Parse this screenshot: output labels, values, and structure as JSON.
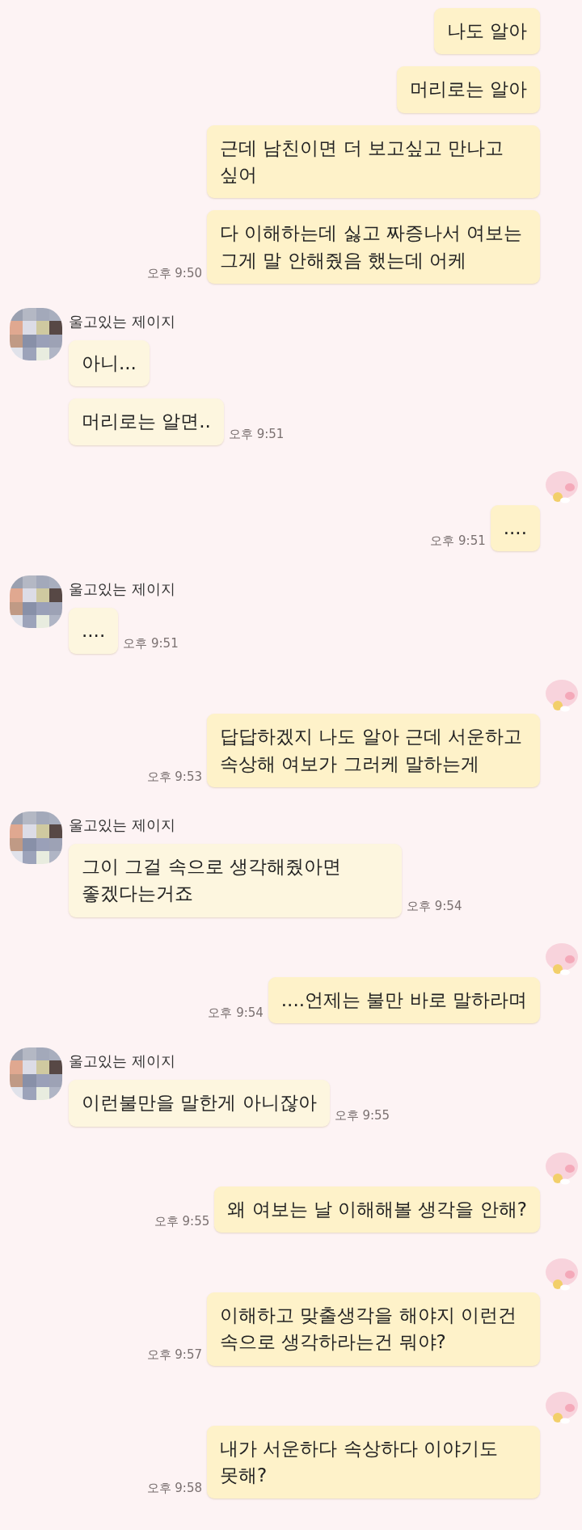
{
  "groups": [
    {
      "kind": "me",
      "show_sticker": false,
      "messages": [
        {
          "text": "나도 알아"
        },
        {
          "text": "머리로는 알아"
        },
        {
          "text": "근데 남친이면 더 보고싶고 만나고 싶어"
        },
        {
          "text": "다 이해하는데 싫고 짜증나서 여보는 그게 말 안해줬음 했는데 어케",
          "time": "오후 9:50"
        }
      ]
    },
    {
      "kind": "other",
      "sender": "울고있는 제이지",
      "messages": [
        {
          "text": "아니..."
        },
        {
          "text": "머리로는 알면..",
          "time": "오후 9:51"
        }
      ]
    },
    {
      "kind": "me",
      "show_sticker": true,
      "messages": [
        {
          "text": "....",
          "time": "오후 9:51"
        }
      ]
    },
    {
      "kind": "other",
      "sender": "울고있는 제이지",
      "messages": [
        {
          "text": "....",
          "time": "오후 9:51"
        }
      ]
    },
    {
      "kind": "me",
      "show_sticker": true,
      "messages": [
        {
          "text": "답답하겠지 나도 알아 근데 서운하고 속상해 여보가 그러케 말하는게",
          "time": "오후 9:53"
        }
      ]
    },
    {
      "kind": "other",
      "sender": "울고있는 제이지",
      "messages": [
        {
          "text": "그이 그걸 속으로 생각해줬아면 좋겠다는거죠",
          "time": "오후 9:54"
        }
      ]
    },
    {
      "kind": "me",
      "show_sticker": true,
      "messages": [
        {
          "text": "....언제는 불만 바로 말하라며",
          "time": "오후 9:54"
        }
      ]
    },
    {
      "kind": "other",
      "sender": "울고있는 제이지",
      "messages": [
        {
          "text": "이런불만을 말한게 아니잖아",
          "time": "오후 9:55"
        }
      ]
    },
    {
      "kind": "me",
      "show_sticker": true,
      "messages": [
        {
          "text": "왜 여보는 날 이해해볼 생각을 안해?",
          "time": "오후 9:55"
        }
      ]
    },
    {
      "kind": "me",
      "show_sticker": true,
      "messages": [
        {
          "text": "이해하고 맞출생각을 해야지 이런건 속으로 생각하라는건 뭐야?",
          "time": "오후 9:57"
        }
      ]
    },
    {
      "kind": "me",
      "show_sticker": true,
      "messages": [
        {
          "text": "내가 서운하다 속상하다 이야기도 못해?",
          "time": "오후 9:58"
        }
      ]
    }
  ]
}
